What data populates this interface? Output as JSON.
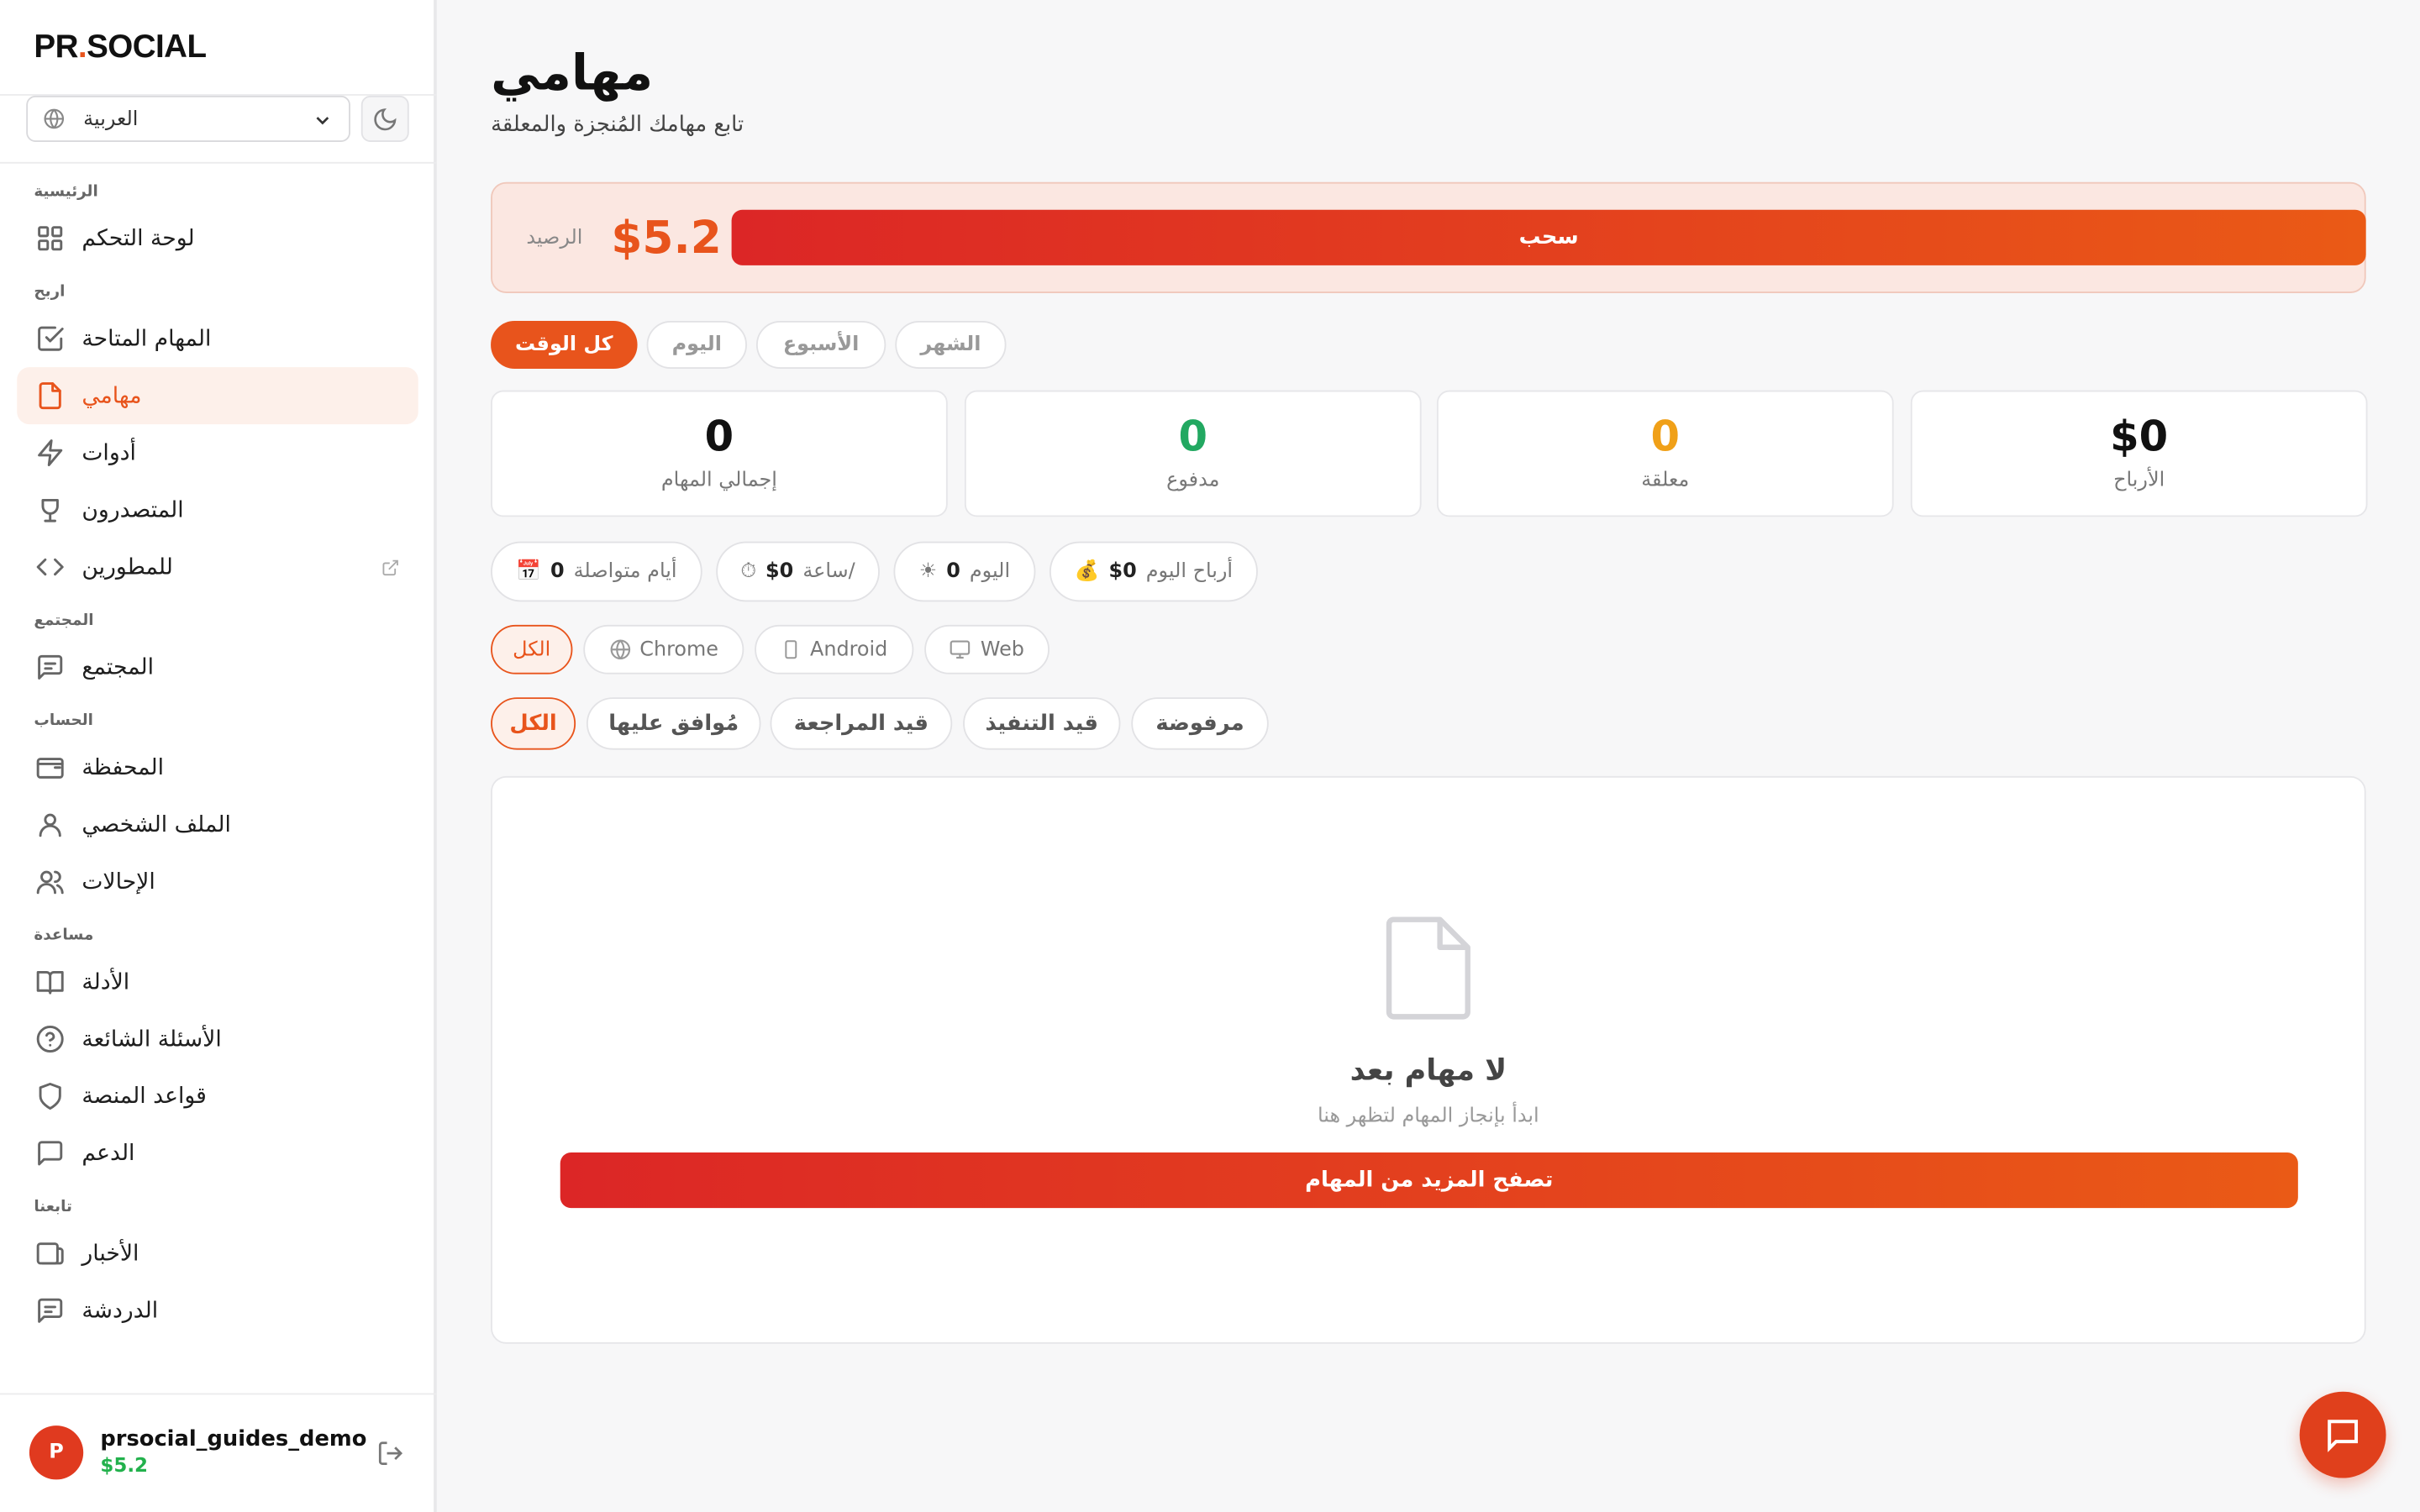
{
  "app": {
    "logo_main": "PR",
    "logo_dot": ".",
    "logo_tail": "SOCIAL"
  },
  "language": {
    "selected": "العربية"
  },
  "sidebar": {
    "sections": [
      {
        "label": "الرئيسية",
        "items": [
          {
            "label": "لوحة التحكم",
            "icon": "dashboard-icon"
          }
        ]
      },
      {
        "label": "اربح",
        "items": [
          {
            "label": "المهام المتاحة",
            "icon": "checkbox-icon"
          },
          {
            "label": "مهامي",
            "icon": "file-icon",
            "active": true
          },
          {
            "label": "أدوات",
            "icon": "lightning-icon"
          },
          {
            "label": "المتصدرون",
            "icon": "trophy-icon"
          },
          {
            "label": "للمطورين",
            "icon": "code-icon",
            "external": true
          }
        ]
      },
      {
        "label": "المجتمع",
        "items": [
          {
            "label": "المجتمع",
            "icon": "message-icon"
          }
        ]
      },
      {
        "label": "الحساب",
        "items": [
          {
            "label": "المحفظة",
            "icon": "wallet-icon"
          },
          {
            "label": "الملف الشخصي",
            "icon": "user-icon"
          },
          {
            "label": "الإحالات",
            "icon": "users-icon"
          }
        ]
      },
      {
        "label": "مساعدة",
        "items": [
          {
            "label": "الأدلة",
            "icon": "book-icon"
          },
          {
            "label": "الأسئلة الشائعة",
            "icon": "help-icon"
          },
          {
            "label": "قواعد المنصة",
            "icon": "shield-icon"
          },
          {
            "label": "الدعم",
            "icon": "chat-icon"
          }
        ]
      },
      {
        "label": "تابعنا",
        "items": [
          {
            "label": "الأخبار",
            "icon": "news-icon"
          },
          {
            "label": "الدردشة",
            "icon": "message-icon"
          }
        ]
      }
    ]
  },
  "user": {
    "avatar_letter": "P",
    "name": "prsocial_guides_demo",
    "balance": "$5.2"
  },
  "page": {
    "title": "مهامي",
    "subtitle": "تابع مهامك المُنجزة والمعلقة"
  },
  "balance": {
    "label": "الرصيد",
    "value": "$5.2",
    "withdraw_label": "سحب"
  },
  "periods": [
    {
      "label": "كل الوقت",
      "active": true
    },
    {
      "label": "اليوم"
    },
    {
      "label": "الأسبوع"
    },
    {
      "label": "الشهر"
    }
  ],
  "stats": [
    {
      "value": "0",
      "label": "إجمالي المهام",
      "color": "#111111"
    },
    {
      "value": "0",
      "label": "مدفوع",
      "color": "#22a861"
    },
    {
      "value": "0",
      "label": "معلقة",
      "color": "#f0a018"
    },
    {
      "value": "$0",
      "label": "الأرباح",
      "color": "#111111"
    }
  ],
  "chips": [
    {
      "label": "أيام متواصلة",
      "value": "0",
      "emoji": "📅"
    },
    {
      "label": "ساعة/",
      "value": "$0",
      "emoji": "⏱"
    },
    {
      "label": "اليوم",
      "value": "0",
      "emoji": "☀"
    },
    {
      "label": "أرباح اليوم",
      "value": "$0",
      "emoji": "💰"
    }
  ],
  "platforms": [
    {
      "label": "الكل",
      "active": true
    },
    {
      "label": "Chrome",
      "icon": "globe-icon"
    },
    {
      "label": "Android",
      "icon": "phone-icon"
    },
    {
      "label": "Web",
      "icon": "monitor-icon"
    }
  ],
  "statuses": [
    {
      "label": "الكل",
      "active": true
    },
    {
      "label": "مُوافق عليها"
    },
    {
      "label": "قيد المراجعة"
    },
    {
      "label": "قيد التنفيذ"
    },
    {
      "label": "مرفوضة"
    }
  ],
  "empty": {
    "title": "لا مهام بعد",
    "subtitle": "ابدأ بإنجاز المهام لتظهر هنا",
    "button": "تصفح المزيد من المهام"
  },
  "colors": {
    "accent": "#e8541c",
    "gradient_start": "#dc2626",
    "gradient_end": "#ea5a16",
    "success": "#22b14c"
  }
}
